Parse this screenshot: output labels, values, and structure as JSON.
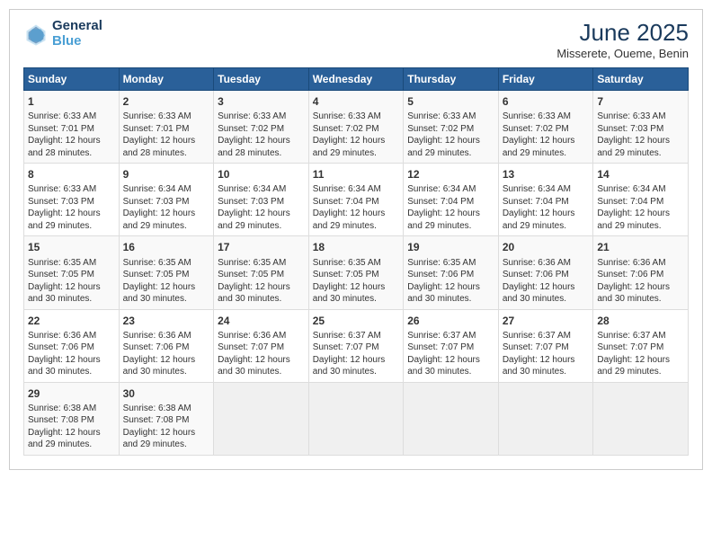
{
  "logo": {
    "line1": "General",
    "line2": "Blue"
  },
  "title": "June 2025",
  "location": "Misserete, Oueme, Benin",
  "headers": [
    "Sunday",
    "Monday",
    "Tuesday",
    "Wednesday",
    "Thursday",
    "Friday",
    "Saturday"
  ],
  "weeks": [
    [
      {
        "day": "1",
        "sunrise": "6:33 AM",
        "sunset": "7:01 PM",
        "daylight": "12 hours and 28 minutes."
      },
      {
        "day": "2",
        "sunrise": "6:33 AM",
        "sunset": "7:01 PM",
        "daylight": "12 hours and 28 minutes."
      },
      {
        "day": "3",
        "sunrise": "6:33 AM",
        "sunset": "7:02 PM",
        "daylight": "12 hours and 28 minutes."
      },
      {
        "day": "4",
        "sunrise": "6:33 AM",
        "sunset": "7:02 PM",
        "daylight": "12 hours and 29 minutes."
      },
      {
        "day": "5",
        "sunrise": "6:33 AM",
        "sunset": "7:02 PM",
        "daylight": "12 hours and 29 minutes."
      },
      {
        "day": "6",
        "sunrise": "6:33 AM",
        "sunset": "7:02 PM",
        "daylight": "12 hours and 29 minutes."
      },
      {
        "day": "7",
        "sunrise": "6:33 AM",
        "sunset": "7:03 PM",
        "daylight": "12 hours and 29 minutes."
      }
    ],
    [
      {
        "day": "8",
        "sunrise": "6:33 AM",
        "sunset": "7:03 PM",
        "daylight": "12 hours and 29 minutes."
      },
      {
        "day": "9",
        "sunrise": "6:34 AM",
        "sunset": "7:03 PM",
        "daylight": "12 hours and 29 minutes."
      },
      {
        "day": "10",
        "sunrise": "6:34 AM",
        "sunset": "7:03 PM",
        "daylight": "12 hours and 29 minutes."
      },
      {
        "day": "11",
        "sunrise": "6:34 AM",
        "sunset": "7:04 PM",
        "daylight": "12 hours and 29 minutes."
      },
      {
        "day": "12",
        "sunrise": "6:34 AM",
        "sunset": "7:04 PM",
        "daylight": "12 hours and 29 minutes."
      },
      {
        "day": "13",
        "sunrise": "6:34 AM",
        "sunset": "7:04 PM",
        "daylight": "12 hours and 29 minutes."
      },
      {
        "day": "14",
        "sunrise": "6:34 AM",
        "sunset": "7:04 PM",
        "daylight": "12 hours and 29 minutes."
      }
    ],
    [
      {
        "day": "15",
        "sunrise": "6:35 AM",
        "sunset": "7:05 PM",
        "daylight": "12 hours and 30 minutes."
      },
      {
        "day": "16",
        "sunrise": "6:35 AM",
        "sunset": "7:05 PM",
        "daylight": "12 hours and 30 minutes."
      },
      {
        "day": "17",
        "sunrise": "6:35 AM",
        "sunset": "7:05 PM",
        "daylight": "12 hours and 30 minutes."
      },
      {
        "day": "18",
        "sunrise": "6:35 AM",
        "sunset": "7:05 PM",
        "daylight": "12 hours and 30 minutes."
      },
      {
        "day": "19",
        "sunrise": "6:35 AM",
        "sunset": "7:06 PM",
        "daylight": "12 hours and 30 minutes."
      },
      {
        "day": "20",
        "sunrise": "6:36 AM",
        "sunset": "7:06 PM",
        "daylight": "12 hours and 30 minutes."
      },
      {
        "day": "21",
        "sunrise": "6:36 AM",
        "sunset": "7:06 PM",
        "daylight": "12 hours and 30 minutes."
      }
    ],
    [
      {
        "day": "22",
        "sunrise": "6:36 AM",
        "sunset": "7:06 PM",
        "daylight": "12 hours and 30 minutes."
      },
      {
        "day": "23",
        "sunrise": "6:36 AM",
        "sunset": "7:06 PM",
        "daylight": "12 hours and 30 minutes."
      },
      {
        "day": "24",
        "sunrise": "6:36 AM",
        "sunset": "7:07 PM",
        "daylight": "12 hours and 30 minutes."
      },
      {
        "day": "25",
        "sunrise": "6:37 AM",
        "sunset": "7:07 PM",
        "daylight": "12 hours and 30 minutes."
      },
      {
        "day": "26",
        "sunrise": "6:37 AM",
        "sunset": "7:07 PM",
        "daylight": "12 hours and 30 minutes."
      },
      {
        "day": "27",
        "sunrise": "6:37 AM",
        "sunset": "7:07 PM",
        "daylight": "12 hours and 30 minutes."
      },
      {
        "day": "28",
        "sunrise": "6:37 AM",
        "sunset": "7:07 PM",
        "daylight": "12 hours and 29 minutes."
      }
    ],
    [
      {
        "day": "29",
        "sunrise": "6:38 AM",
        "sunset": "7:08 PM",
        "daylight": "12 hours and 29 minutes."
      },
      {
        "day": "30",
        "sunrise": "6:38 AM",
        "sunset": "7:08 PM",
        "daylight": "12 hours and 29 minutes."
      },
      null,
      null,
      null,
      null,
      null
    ]
  ],
  "labels": {
    "sunrise": "Sunrise:",
    "sunset": "Sunset:",
    "daylight": "Daylight:"
  }
}
